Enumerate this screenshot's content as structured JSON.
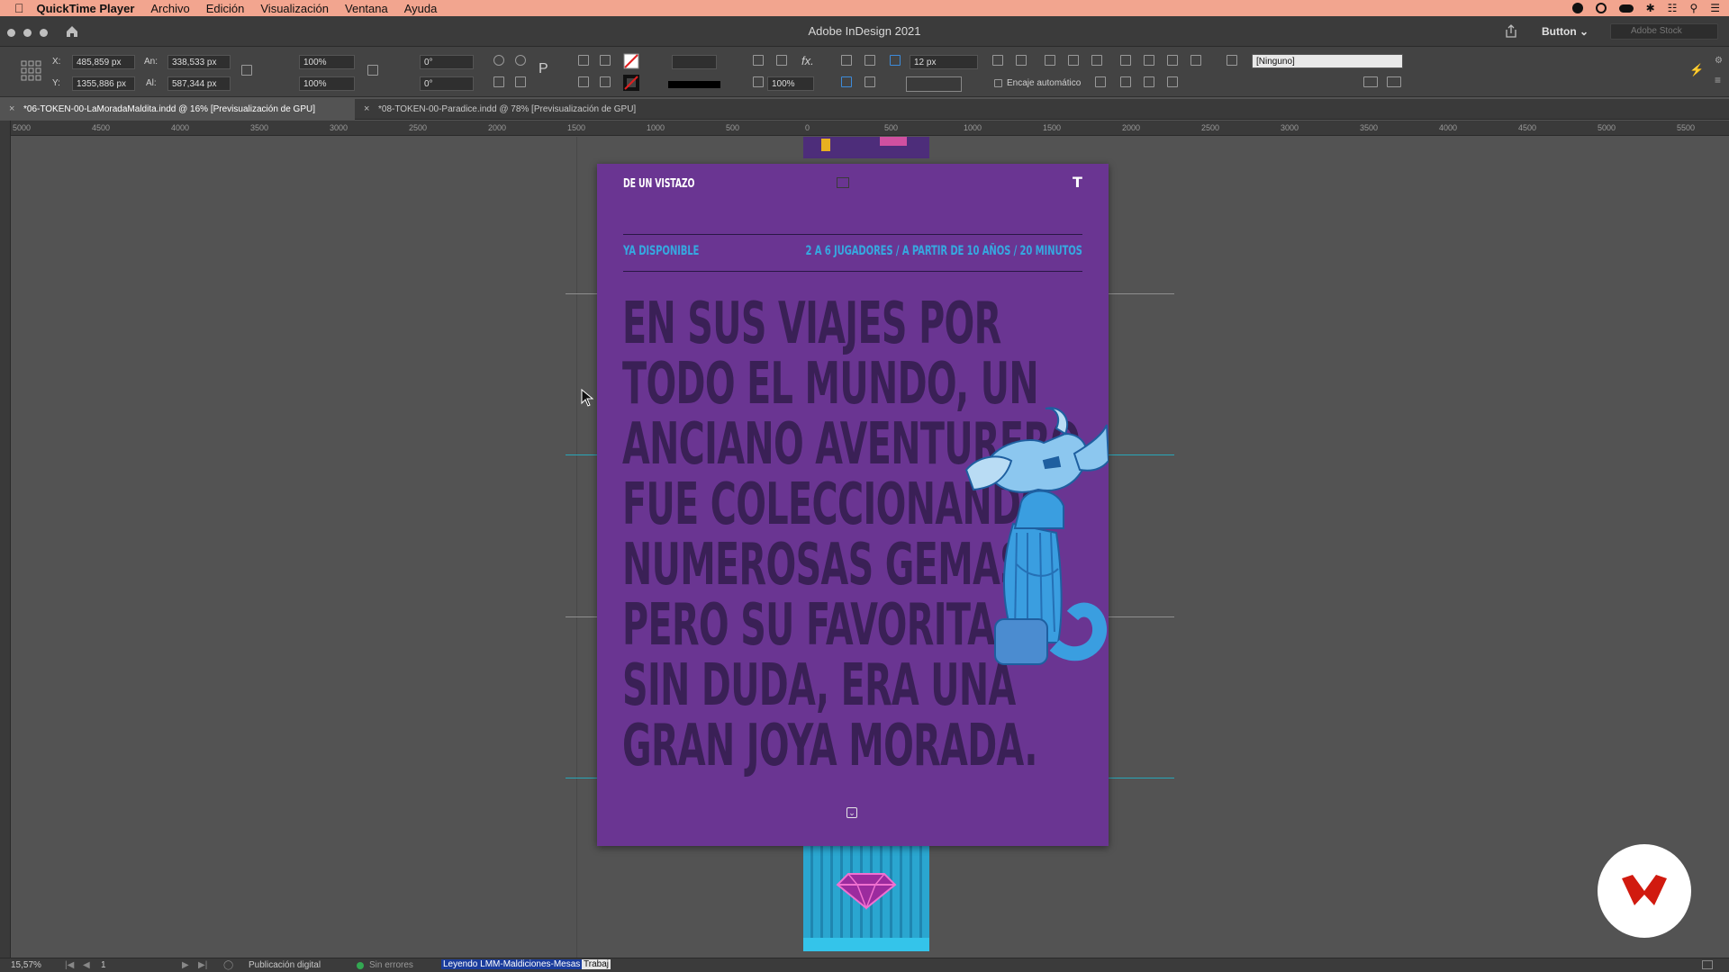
{
  "menubar": {
    "app": "QuickTime Player",
    "items": [
      "Archivo",
      "Edición",
      "Visualización",
      "Ventana",
      "Ayuda"
    ]
  },
  "titlebar": {
    "title": "Adobe InDesign 2021",
    "workspace": "Button",
    "search_placeholder": "Adobe Stock"
  },
  "control": {
    "x_label": "X:",
    "x_value": "485,859 px",
    "y_label": "Y:",
    "y_value": "1355,886 px",
    "w_label": "An:",
    "w_value": "338,533 px",
    "h_label": "Al:",
    "h_value": "587,344 px",
    "scale_x": "100%",
    "scale_y": "100%",
    "rotate": "0°",
    "shear": "0°",
    "stroke_weight": "12 px",
    "opacity": "100%",
    "autofit_label": "Encaje automático",
    "style_value": "[Ninguno]"
  },
  "tabs": [
    {
      "label": "*06-TOKEN-00-LaMoradaMaldita.indd @ 16% [Previsualización de GPU]",
      "active": true
    },
    {
      "label": "*08-TOKEN-00-Paradice.indd @ 78% [Previsualización de GPU]",
      "active": false
    }
  ],
  "ruler": {
    "ticks": [
      "5000",
      "4500",
      "4000",
      "3500",
      "3000",
      "2500",
      "2000",
      "1500",
      "1000",
      "500",
      "0",
      "500",
      "1000",
      "1500",
      "2000",
      "2500",
      "3000",
      "3500",
      "4000",
      "4500",
      "5000",
      "5500"
    ]
  },
  "page": {
    "header_left": "DE UN VISTAZO",
    "logo_letter": "T",
    "status": "YA DISPONIBLE",
    "players": "2 A 6 JUGADORES",
    "age": "A PARTIR DE 10 AÑOS",
    "time": "20 MINUTOS",
    "sep": "/",
    "hero_lines": [
      "EN SUS VIAJES POR",
      "TODO EL MUNDO, UN",
      "ANCIANO AVENTURERO",
      "FUE COLECCIONANDO",
      "NUMEROSAS GEMAS.",
      "PERO SU FAVORITA,",
      "SIN DUDA, ERA UNA",
      "GRAN JOYA MORADA."
    ]
  },
  "statusbar": {
    "zoom": "15,57%",
    "page_num": "1",
    "mode": "Publicación digital",
    "preflight": "Sin errores",
    "highlight": "Leyendo LMM-Maldiciones-Mesas",
    "tail": "Trabaj"
  },
  "colors": {
    "menubar": "#f2a58f",
    "page_purple": "#6a3592",
    "hero_text": "#3a2056",
    "accent_blue": "#2fa9e0",
    "guide_cyan": "#29a6b8"
  }
}
